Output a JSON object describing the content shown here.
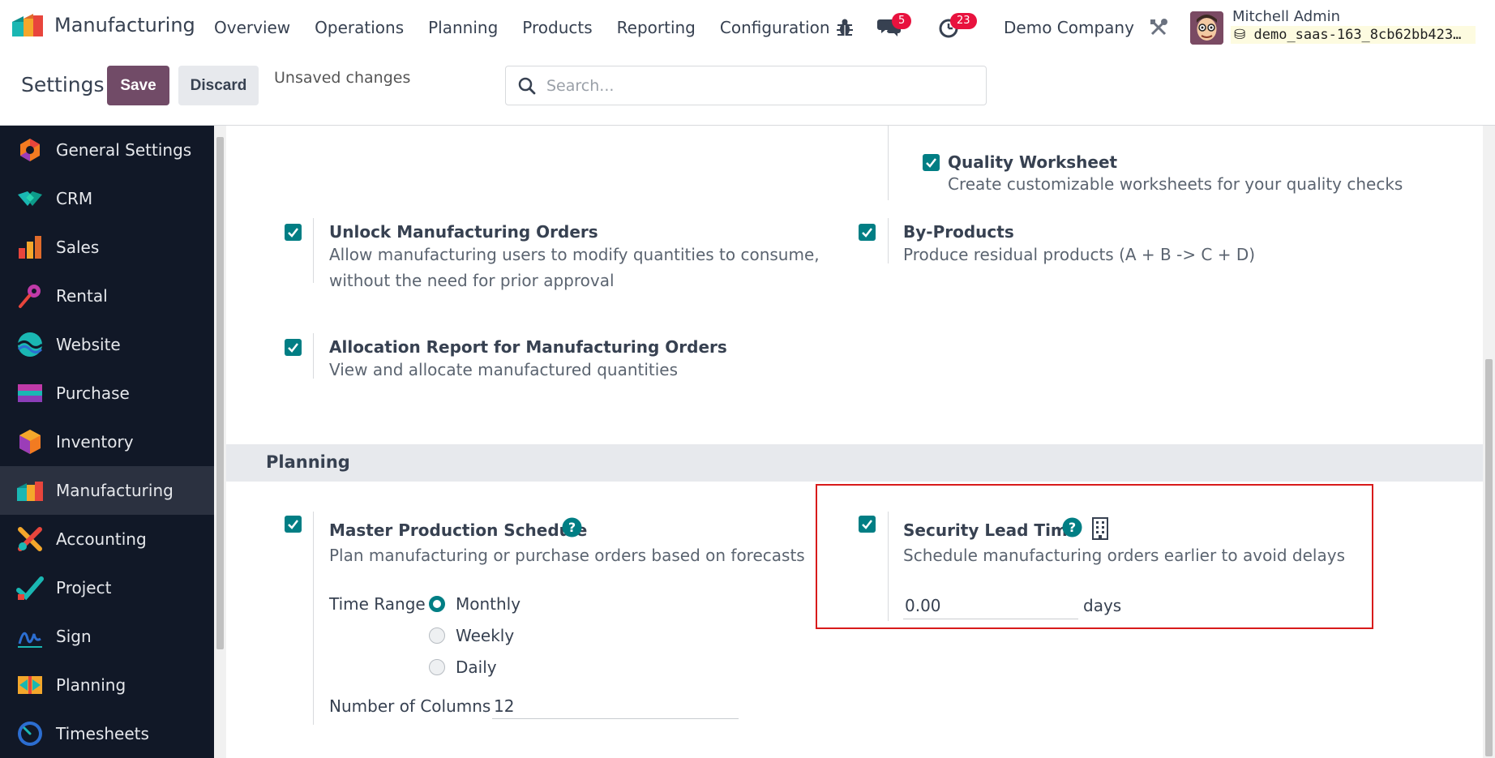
{
  "navbar": {
    "app_name": "Manufacturing",
    "menu": [
      "Overview",
      "Operations",
      "Planning",
      "Products",
      "Reporting",
      "Configuration"
    ],
    "messages_count": "5",
    "activities_count": "23",
    "company": "Demo Company",
    "user_name": "Mitchell Admin",
    "database": "demo_saas-163_8cb62bb423…"
  },
  "control_panel": {
    "title": "Settings",
    "save_label": "Save",
    "discard_label": "Discard",
    "unsaved_label": "Unsaved changes",
    "search_placeholder": "Search..."
  },
  "sidebar": {
    "items": [
      {
        "label": "General Settings",
        "icon": "general-settings-icon"
      },
      {
        "label": "CRM",
        "icon": "crm-icon"
      },
      {
        "label": "Sales",
        "icon": "sales-icon"
      },
      {
        "label": "Rental",
        "icon": "rental-icon"
      },
      {
        "label": "Website",
        "icon": "website-icon"
      },
      {
        "label": "Purchase",
        "icon": "purchase-icon"
      },
      {
        "label": "Inventory",
        "icon": "inventory-icon"
      },
      {
        "label": "Manufacturing",
        "icon": "manufacturing-icon",
        "active": true
      },
      {
        "label": "Accounting",
        "icon": "accounting-icon"
      },
      {
        "label": "Project",
        "icon": "project-icon"
      },
      {
        "label": "Sign",
        "icon": "sign-icon"
      },
      {
        "label": "Planning",
        "icon": "planning-icon"
      },
      {
        "label": "Timesheets",
        "icon": "timesheets-icon"
      }
    ]
  },
  "settings": {
    "quality_worksheet": {
      "title": "Quality Worksheet",
      "desc": "Create customizable worksheets for your quality checks",
      "checked": true
    },
    "unlock_mo": {
      "title": "Unlock Manufacturing Orders",
      "desc1": "Allow manufacturing users to modify quantities to consume,",
      "desc2": "without the need for prior approval",
      "checked": true
    },
    "by_products": {
      "title": "By-Products",
      "desc": "Produce residual products (A + B -> C + D)",
      "checked": true
    },
    "allocation_report": {
      "title": "Allocation Report for Manufacturing Orders",
      "desc": "View and allocate manufactured quantities",
      "checked": true
    },
    "planning_section": "Planning",
    "mps": {
      "title": "Master Production Schedule",
      "desc": "Plan manufacturing or purchase orders based on forecasts",
      "checked": true,
      "time_range_label": "Time Range",
      "time_range_options": [
        "Monthly",
        "Weekly",
        "Daily"
      ],
      "time_range_selected": "Monthly",
      "columns_label": "Number of Columns",
      "columns_value": "12"
    },
    "security_lead_time": {
      "title": "Security Lead Time",
      "desc": "Schedule manufacturing orders earlier to avoid delays",
      "checked": true,
      "value": "0.00",
      "unit": "days"
    }
  },
  "colors": {
    "brand": "#714b67",
    "accent": "#017e84",
    "sidebar_bg": "#111827",
    "badge": "#e8123e",
    "highlight": "#d81b1b"
  }
}
